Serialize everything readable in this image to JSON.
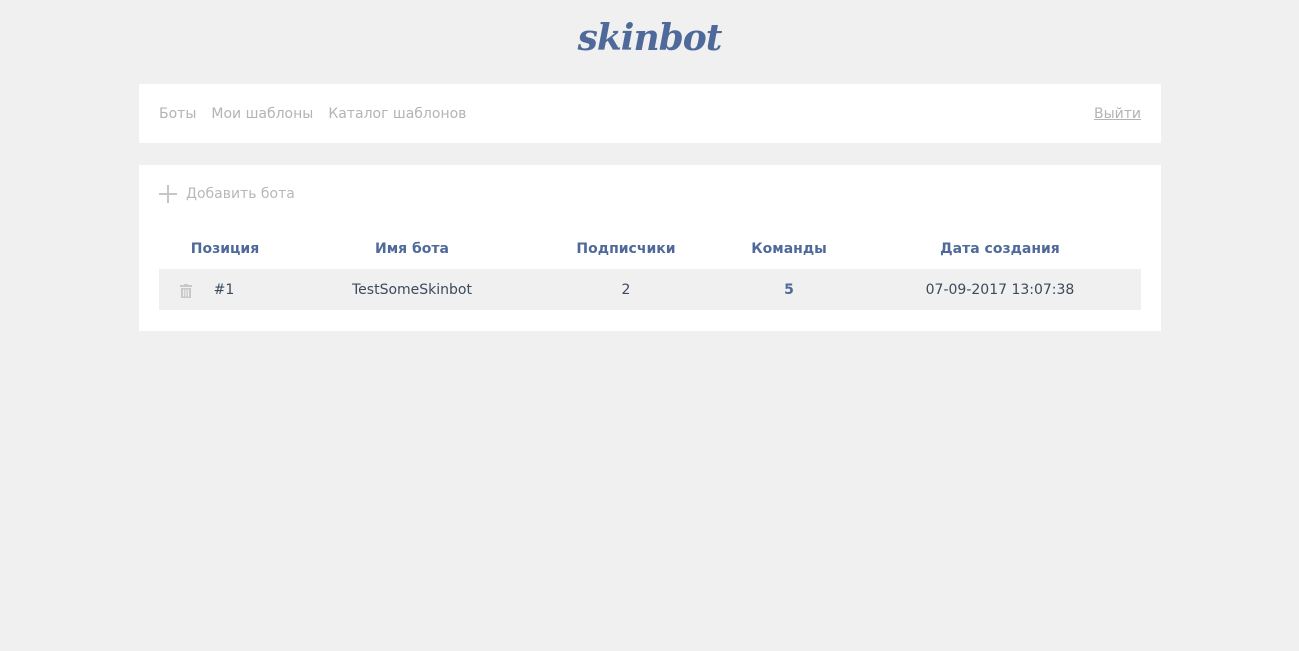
{
  "brand": {
    "logo_text": "skinbot",
    "color": "#4f6a9a"
  },
  "nav": {
    "items": [
      {
        "label": "Боты"
      },
      {
        "label": "Мои шаблоны"
      },
      {
        "label": "Каталог шаблонов"
      }
    ],
    "logout_label": "Выйти"
  },
  "bots": {
    "add_label": "Добавить бота",
    "columns": [
      "Позиция",
      "Имя бота",
      "Подписчики",
      "Команды",
      "Дата создания"
    ],
    "rows": [
      {
        "position": "#1",
        "name": "TestSomeSkinbot",
        "subscribers": "2",
        "commands": "5",
        "created": "07-09-2017 13:07:38"
      }
    ]
  },
  "icons": {
    "add": "plus-icon",
    "delete": "trash-icon"
  }
}
